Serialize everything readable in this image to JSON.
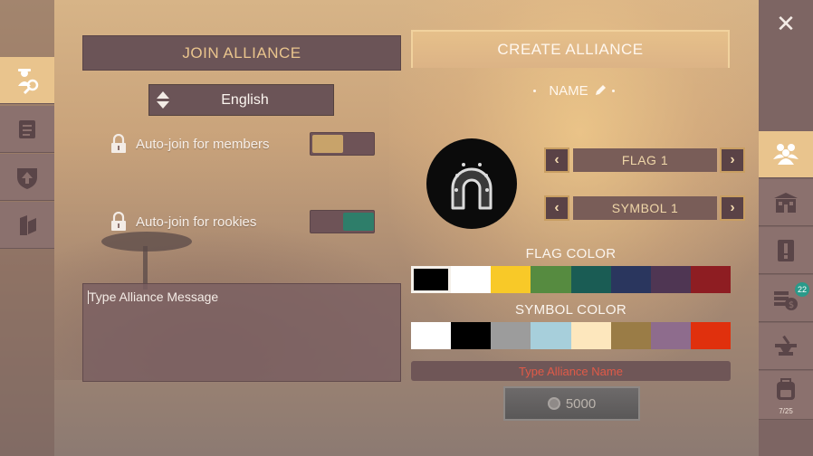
{
  "tabs": {
    "join": "JOIN ALLIANCE",
    "create": "CREATE ALLIANCE"
  },
  "language": {
    "selected": "English"
  },
  "toggles": [
    {
      "label": "Auto-join for members",
      "state": "off",
      "knob_color": "#c8a36a"
    },
    {
      "label": "Auto-join for rookies",
      "state": "on",
      "knob_color": "#2e7e6a"
    }
  ],
  "message": {
    "placeholder": "Type Alliance Message"
  },
  "create": {
    "name_label": "NAME",
    "flag_label": "FLAG 1",
    "symbol_label": "SYMBOL 1",
    "flag_color_title": "FLAG COLOR",
    "symbol_color_title": "SYMBOL COLOR",
    "flag_colors": [
      "#000000",
      "#ffffff",
      "#f8c928",
      "#568b40",
      "#1a5c54",
      "#2a365e",
      "#4f3653",
      "#8e1d22"
    ],
    "flag_color_selected": 0,
    "symbol_colors": [
      "#ffffff",
      "#000000",
      "#9c9c9c",
      "#a7cfdb",
      "#fde7bd",
      "#9a7c46",
      "#8e6c8d",
      "#e0300d"
    ],
    "name_warning": "Type Alliance Name",
    "cost": "5000"
  },
  "right_rail": {
    "close_icon": "close-icon",
    "bank_badge": "22",
    "backpack_counter": "7/25"
  },
  "colors": {
    "accent": "#e9c48d",
    "panel": "#6b5457",
    "warning": "#e05a48"
  }
}
